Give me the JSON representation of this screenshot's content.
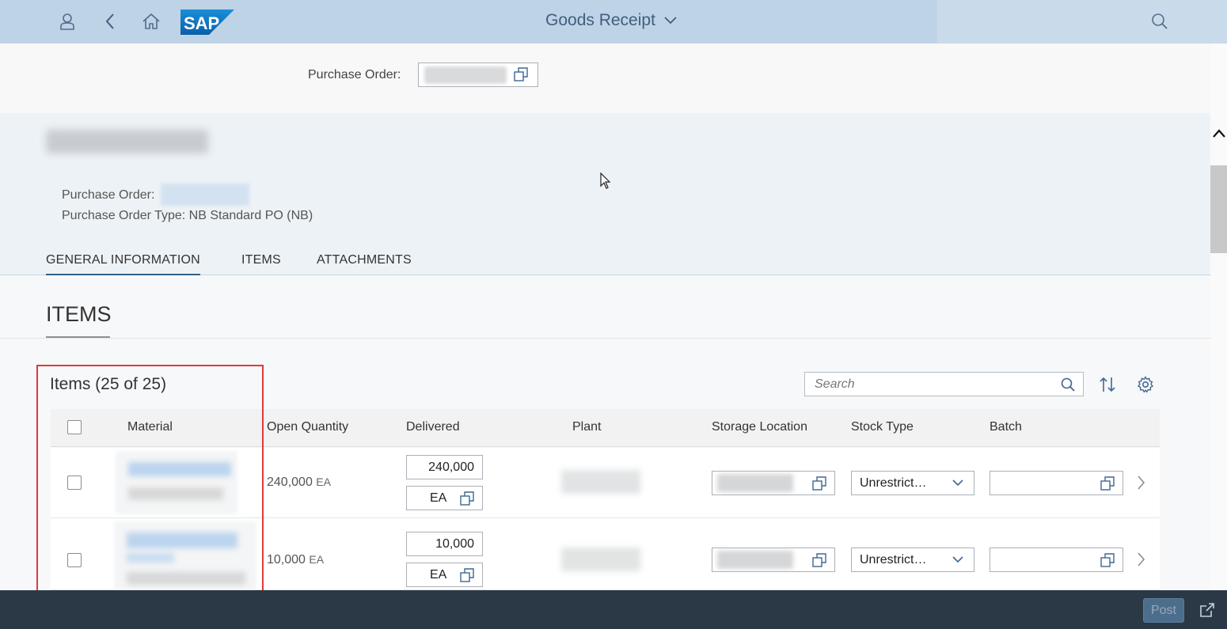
{
  "shell": {
    "title": "Goods Receipt",
    "logo_text": "SAP",
    "icons": [
      "user-icon",
      "back-icon",
      "home-icon",
      "search-icon"
    ]
  },
  "po_bar": {
    "label": "Purchase Order:"
  },
  "header": {
    "po_label": "Purchase Order:",
    "po_type": "Purchase Order Type: NB Standard PO (NB)"
  },
  "tabs": [
    {
      "label": "GENERAL INFORMATION",
      "selected": true
    },
    {
      "label": "ITEMS",
      "selected": false
    },
    {
      "label": "ATTACHMENTS",
      "selected": false
    }
  ],
  "section": {
    "title": "ITEMS"
  },
  "table": {
    "title": "Items (25 of 25)",
    "search_placeholder": "Search",
    "columns": [
      "Material",
      "Open Quantity",
      "Delivered",
      "Plant",
      "Storage Location",
      "Stock Type",
      "Batch"
    ],
    "rows": [
      {
        "open_qty": "240,000",
        "open_unit": "EA",
        "delivered": "240,000",
        "delivered_unit": "EA",
        "stock_type": "Unrestrict…",
        "batch": ""
      },
      {
        "open_qty": "10,000",
        "open_unit": "EA",
        "delivered": "10,000",
        "delivered_unit": "EA",
        "stock_type": "Unrestrict…",
        "batch": ""
      }
    ]
  },
  "footer": {
    "post_label": "Post"
  },
  "colors": {
    "shell_bg": "#bfd3e6",
    "header_bg": "#edf2f6",
    "footer_bg": "#2b3947",
    "highlight": "#e0393e",
    "accent": "#346187"
  }
}
